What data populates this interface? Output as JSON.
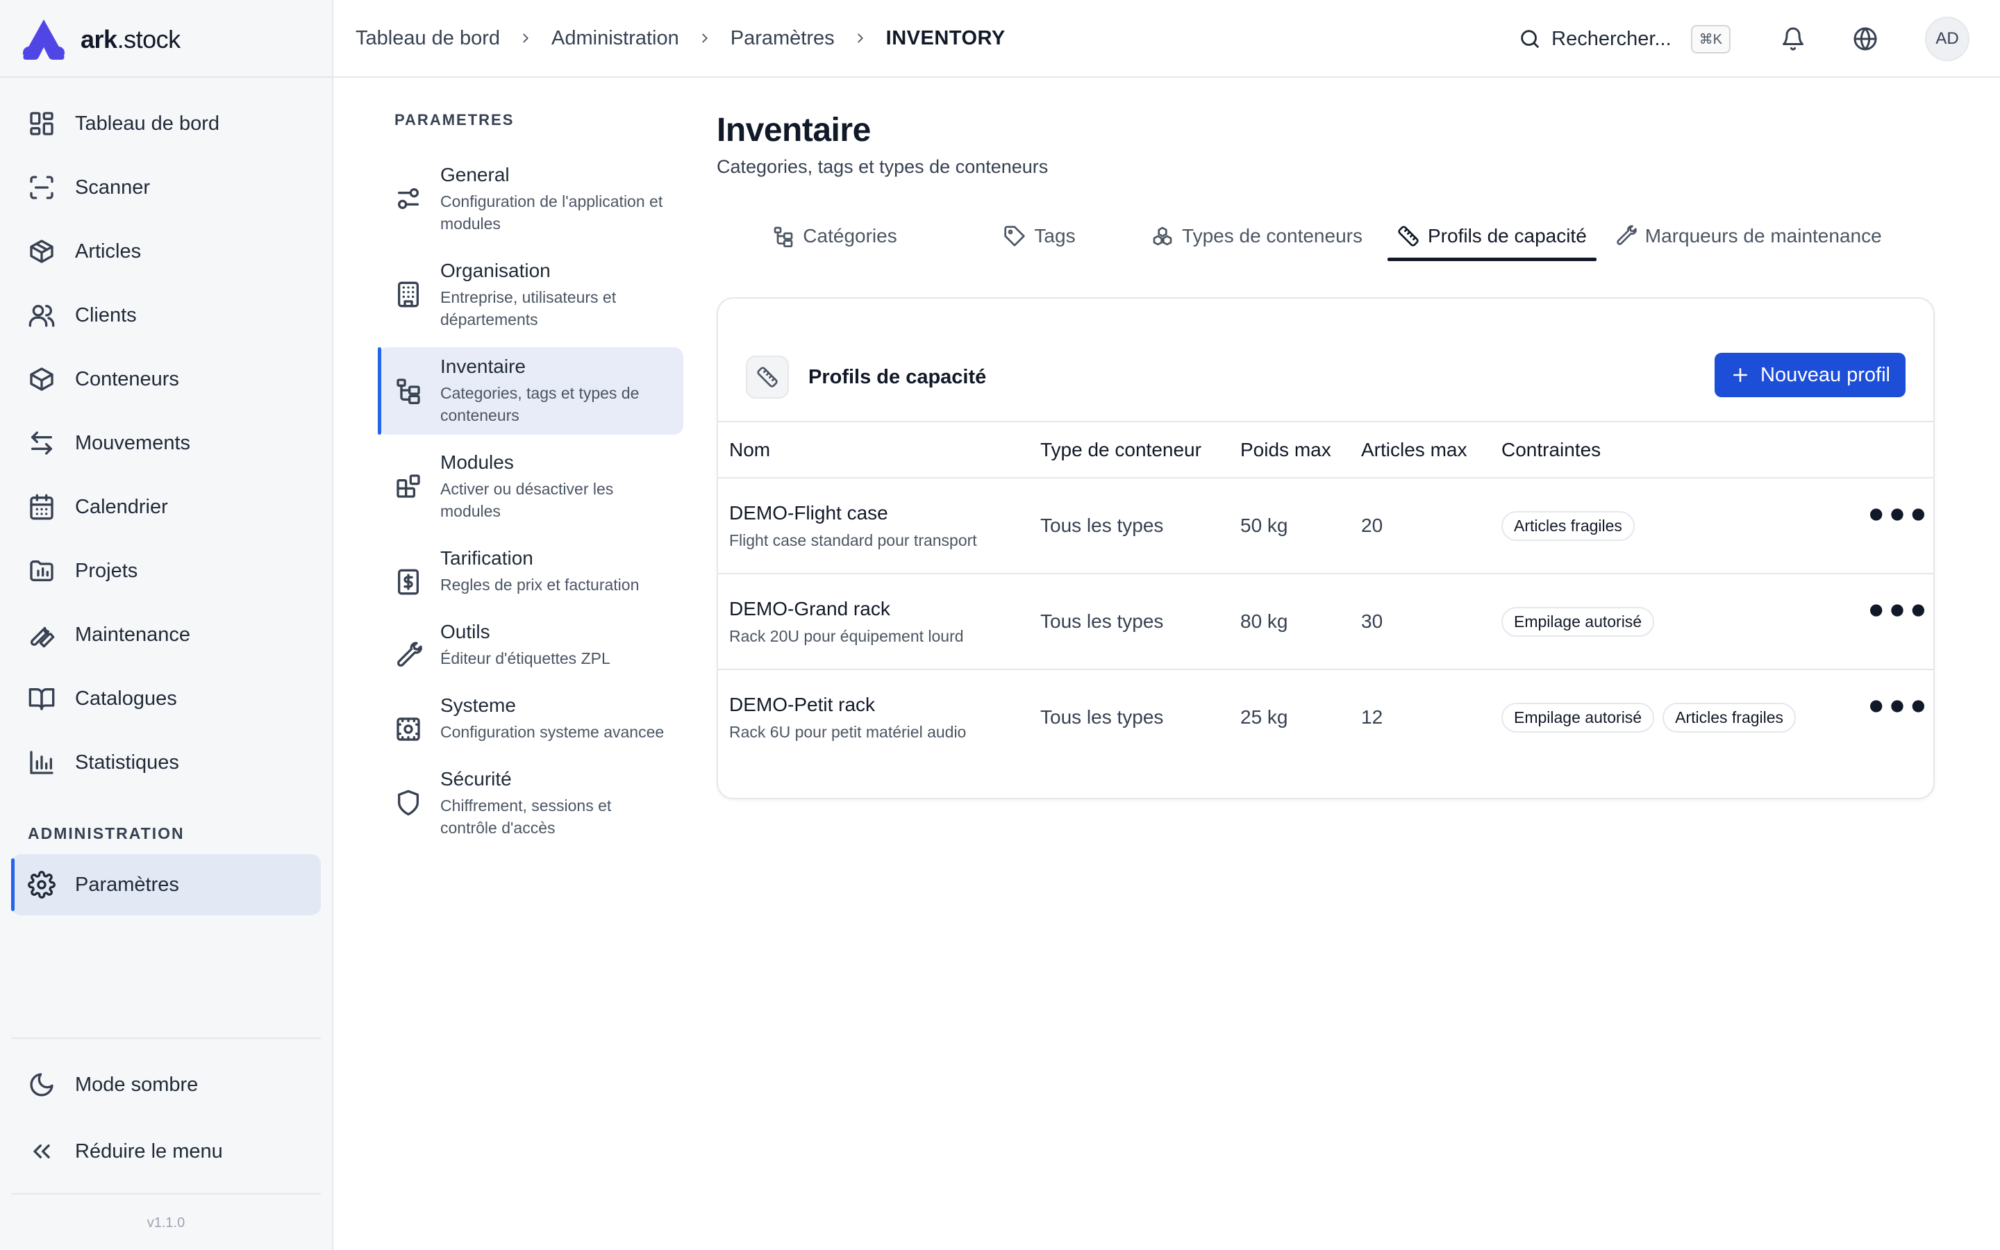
{
  "brand": {
    "name_bold": "ark",
    "name_rest": ".stock"
  },
  "sidebar": {
    "items": [
      {
        "label": "Tableau de bord",
        "icon": "dashboard-icon"
      },
      {
        "label": "Scanner",
        "icon": "scan-icon"
      },
      {
        "label": "Articles",
        "icon": "package-icon"
      },
      {
        "label": "Clients",
        "icon": "users-icon"
      },
      {
        "label": "Conteneurs",
        "icon": "box-icon"
      },
      {
        "label": "Mouvements",
        "icon": "arrows-icon"
      },
      {
        "label": "Calendrier",
        "icon": "calendar-icon"
      },
      {
        "label": "Projets",
        "icon": "folder-icon"
      },
      {
        "label": "Maintenance",
        "icon": "wrench-icon"
      },
      {
        "label": "Catalogues",
        "icon": "book-icon"
      },
      {
        "label": "Statistiques",
        "icon": "chart-icon"
      }
    ],
    "admin_section": "ADMINISTRATION",
    "admin_items": [
      {
        "label": "Paramètres",
        "icon": "gear-icon"
      }
    ],
    "dark_mode": "Mode sombre",
    "collapse": "Réduire le menu",
    "version": "v1.1.0"
  },
  "breadcrumb": [
    "Tableau de bord",
    "Administration",
    "Paramètres",
    "INVENTORY"
  ],
  "topbar": {
    "search_label": "Rechercher...",
    "shortcut": "⌘K",
    "avatar": "AD"
  },
  "subnav": {
    "title": "PARAMETRES",
    "items": [
      {
        "label": "General",
        "desc": "Configuration de l'application et modules",
        "icon": "sliders-icon"
      },
      {
        "label": "Organisation",
        "desc": "Entreprise, utilisateurs et départements",
        "icon": "building-icon"
      },
      {
        "label": "Inventaire",
        "desc": "Categories, tags et types de conteneurs",
        "icon": "tree-icon"
      },
      {
        "label": "Modules",
        "desc": "Activer ou désactiver les modules",
        "icon": "blocks-icon"
      },
      {
        "label": "Tarification",
        "desc": "Regles de prix et facturation",
        "icon": "receipt-icon"
      },
      {
        "label": "Outils",
        "desc": "Éditeur d'étiquettes ZPL",
        "icon": "wrench-icon"
      },
      {
        "label": "Systeme",
        "desc": "Configuration systeme avancee",
        "icon": "system-icon"
      },
      {
        "label": "Sécurité",
        "desc": "Chiffrement, sessions et contrôle d'accès",
        "icon": "shield-icon"
      }
    ]
  },
  "main": {
    "title": "Inventaire",
    "subtitle": "Categories, tags et types de conteneurs",
    "tabs": [
      {
        "label": "Catégories",
        "icon": "tree-icon"
      },
      {
        "label": "Tags",
        "icon": "tag-icon"
      },
      {
        "label": "Types de conteneurs",
        "icon": "boxes-icon"
      },
      {
        "label": "Profils de capacité",
        "icon": "ruler-icon"
      },
      {
        "label": "Marqueurs de maintenance",
        "icon": "wrench-icon"
      }
    ],
    "active_tab": "Profils de capacité",
    "card": {
      "title": "Profils de capacité",
      "new_button": "Nouveau profil",
      "columns": [
        "Nom",
        "Type de conteneur",
        "Poids max",
        "Articles max",
        "Contraintes"
      ],
      "rows": [
        {
          "name": "DEMO-Flight case",
          "desc": "Flight case standard pour transport",
          "type": "Tous les types",
          "weight": "50 kg",
          "items": "20",
          "tags": [
            "Articles fragiles"
          ]
        },
        {
          "name": "DEMO-Grand rack",
          "desc": "Rack 20U pour équipement lourd",
          "type": "Tous les types",
          "weight": "80 kg",
          "items": "30",
          "tags": [
            "Empilage autorisé"
          ]
        },
        {
          "name": "DEMO-Petit rack",
          "desc": "Rack 6U pour petit matériel audio",
          "type": "Tous les types",
          "weight": "25 kg",
          "items": "12",
          "tags": [
            "Empilage autorisé",
            "Articles fragiles"
          ]
        }
      ]
    }
  },
  "colors": {
    "accent": "#1d4ed8",
    "active_bg": "#e3e8f5",
    "border": "#e5e7eb"
  }
}
